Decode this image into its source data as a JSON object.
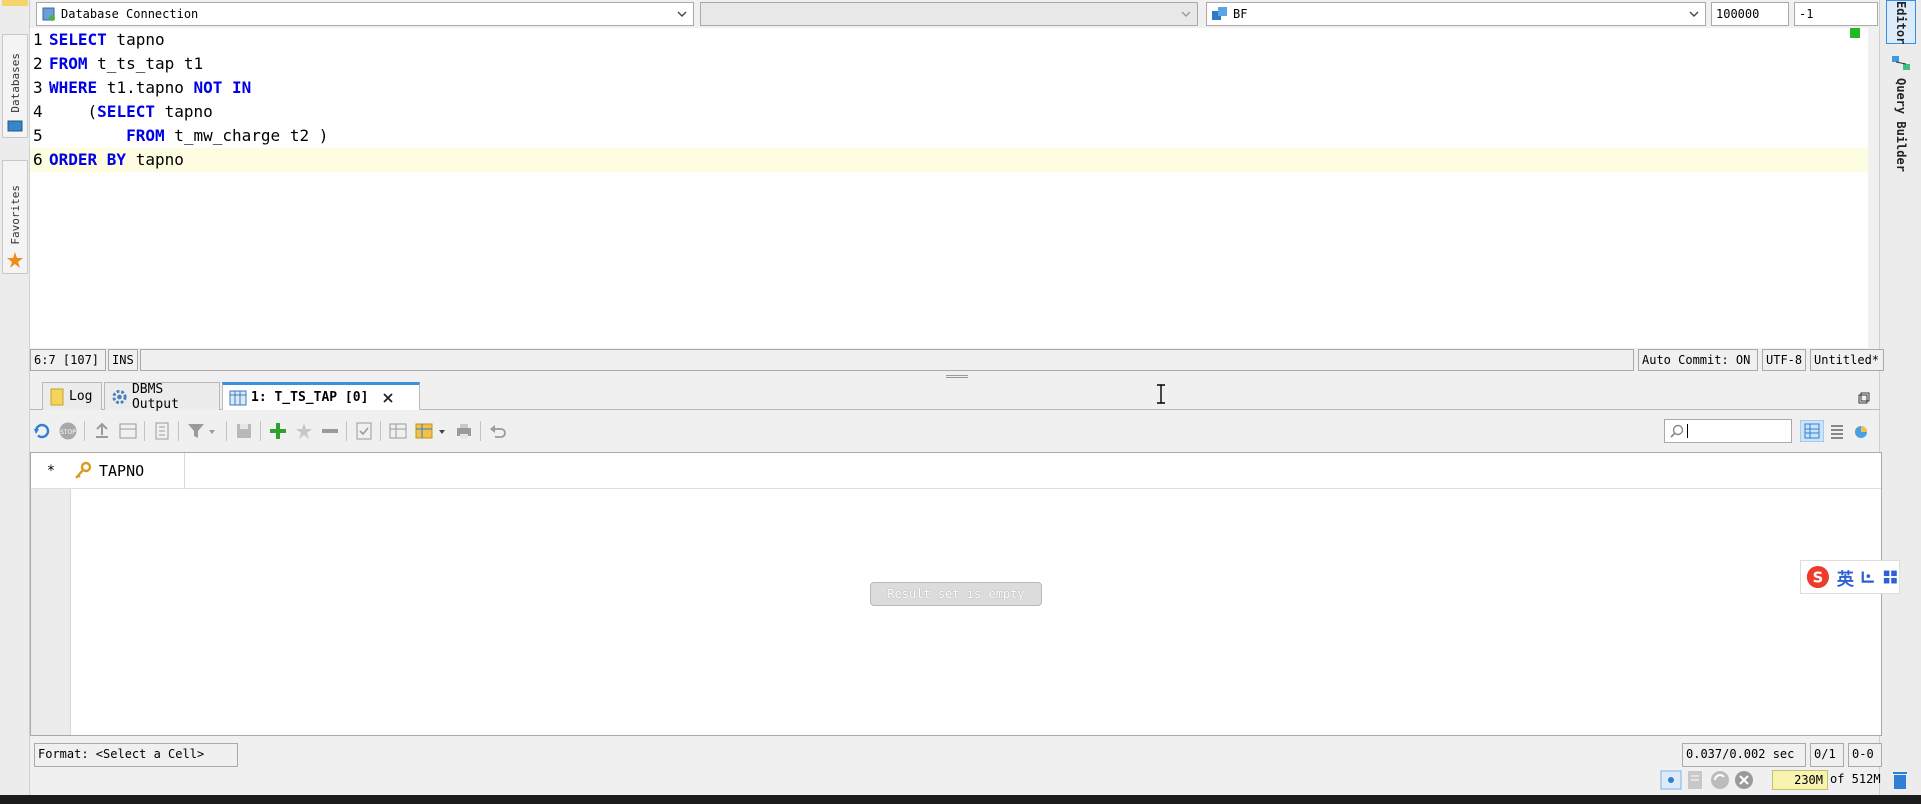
{
  "toolbar": {
    "connection_label": "Database Connection",
    "schema_value": "",
    "session_label": "BF",
    "row_limit": "100000",
    "fetch_value": "-1"
  },
  "left_strip": {
    "databases_label": "Databases",
    "favorites_label": "Favorites"
  },
  "right_strip": {
    "editor_label": "Editor",
    "query_builder_label": "Query Builder"
  },
  "editor": {
    "lines": [
      {
        "num": "1",
        "parts": [
          {
            "t": "SELECT",
            "kw": true
          },
          {
            "t": " tapno",
            "kw": false
          }
        ]
      },
      {
        "num": "2",
        "parts": [
          {
            "t": "FROM",
            "kw": true
          },
          {
            "t": " t_ts_tap t1",
            "kw": false
          }
        ]
      },
      {
        "num": "3",
        "parts": [
          {
            "t": "WHERE",
            "kw": true
          },
          {
            "t": " t1.tapno ",
            "kw": false
          },
          {
            "t": "NOT IN",
            "kw": true
          }
        ]
      },
      {
        "num": "4",
        "parts": [
          {
            "t": "    (",
            "kw": false
          },
          {
            "t": "SELECT",
            "kw": true
          },
          {
            "t": " tapno",
            "kw": false
          }
        ]
      },
      {
        "num": "5",
        "parts": [
          {
            "t": "        ",
            "kw": false
          },
          {
            "t": "FROM",
            "kw": true
          },
          {
            "t": " t_mw_charge t2 )",
            "kw": false
          }
        ]
      },
      {
        "num": "6",
        "parts": [
          {
            "t": "ORDER BY",
            "kw": true
          },
          {
            "t": " tapno",
            "kw": false
          }
        ]
      }
    ]
  },
  "editor_status": {
    "position": "6:7 [107]",
    "mode": "INS",
    "auto_commit": "Auto Commit: ON",
    "encoding": "UTF-8",
    "file": "Untitled*"
  },
  "tabs": [
    {
      "label": "Log"
    },
    {
      "label": "DBMS Output"
    },
    {
      "label": "1: T_TS_TAP [0]"
    }
  ],
  "grid": {
    "row_marker": "*",
    "columns": [
      "TAPNO"
    ],
    "empty_message": "Result set is empty"
  },
  "search": {
    "placeholder": ""
  },
  "result_status": {
    "format_label": "Format:  <Select  a  Cell>",
    "timing": "0.037/0.002 sec",
    "rows": "0/1",
    "range": "0-0"
  },
  "memory": {
    "used": "230M",
    "total": "of 512M"
  },
  "ime": {
    "lang_label": "英"
  },
  "colors": {
    "keyword": "#0000e6",
    "current_line": "#fffde1",
    "active_tab_accent": "#3b8fe0",
    "add_icon": "#2ea12e"
  }
}
